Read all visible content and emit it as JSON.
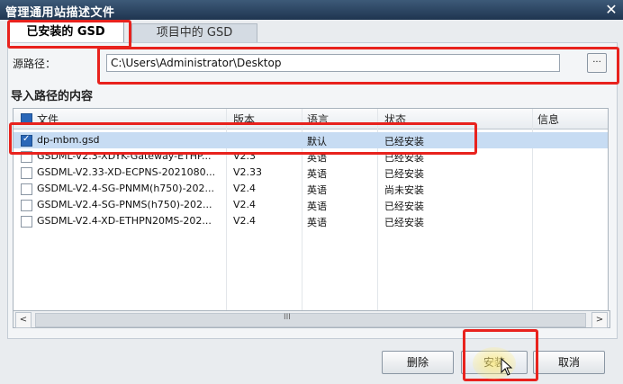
{
  "window": {
    "title": "管理通用站描述文件",
    "close_glyph": "✕"
  },
  "tabs": [
    {
      "label": "已安装的 GSD"
    },
    {
      "label": "项目中的 GSD"
    }
  ],
  "source": {
    "label": "源路径：",
    "value": "C:\\Users\\Administrator\\Desktop",
    "browse_label": "..."
  },
  "section_title": "导入路径的内容",
  "table": {
    "headers": [
      "文件",
      "版本",
      "语言",
      "状态",
      "信息"
    ],
    "rows": [
      {
        "file": "dp-mbm.gsd",
        "version": "",
        "language": "默认",
        "status": "已经安装",
        "info": "",
        "checked": true
      },
      {
        "file": "GSDML-V2.3-XDYK-Gateway-ETHP...",
        "version": "V2.3",
        "language": "英语",
        "status": "已经安装",
        "info": "",
        "checked": false
      },
      {
        "file": "GSDML-V2.33-XD-ECPNS-2021080...",
        "version": "V2.33",
        "language": "英语",
        "status": "已经安装",
        "info": "",
        "checked": false
      },
      {
        "file": "GSDML-V2.4-SG-PNMM(h750)-202...",
        "version": "V2.4",
        "language": "英语",
        "status": "尚未安装",
        "info": "",
        "checked": false
      },
      {
        "file": "GSDML-V2.4-SG-PNMS(h750)-202...",
        "version": "V2.4",
        "language": "英语",
        "status": "已经安装",
        "info": "",
        "checked": false
      },
      {
        "file": "GSDML-V2.4-XD-ETHPN20MS-202...",
        "version": "V2.4",
        "language": "英语",
        "status": "已经安装",
        "info": "",
        "checked": false
      }
    ]
  },
  "scrollbar": {
    "left_glyph": "<",
    "right_glyph": ">",
    "grip": "III"
  },
  "buttons": {
    "delete": "删除",
    "install": "安装",
    "cancel": "取消"
  },
  "colors": {
    "highlight": "#e8221d",
    "selection": "#c7dcf3",
    "titlebar": "#1f3550"
  }
}
